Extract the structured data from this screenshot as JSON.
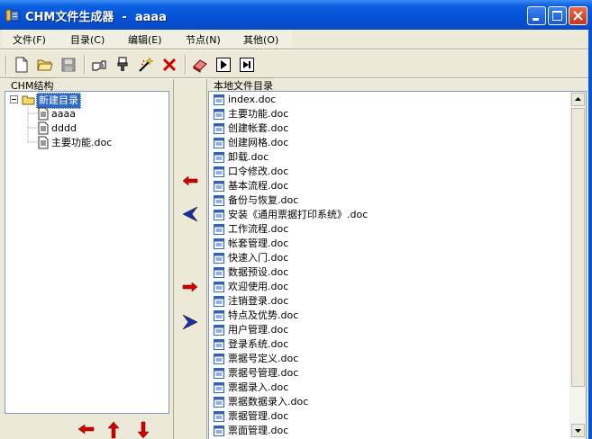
{
  "window": {
    "title": "CHM文件生成器  -  aaaa"
  },
  "menu": [
    "文件(F)",
    "目录(C)",
    "编辑(E)",
    "节点(N)",
    "其他(O)"
  ],
  "toolbar": {
    "icons": [
      "new-file-icon",
      "open-folder-icon",
      "save-icon",
      "hand-pointer-icon",
      "stamp-icon",
      "wand-icon",
      "delete-x-icon",
      "eraser-icon",
      "play-icon",
      "step-icon"
    ]
  },
  "left_panel": {
    "label": "CHM结构",
    "root": "新建目录",
    "children": [
      "aaaa",
      "dddd",
      "主要功能.doc"
    ]
  },
  "right_panel": {
    "label": "本地文件目录",
    "files": [
      "index.doc",
      "主要功能.doc",
      "创建帐套.doc",
      "创建网格.doc",
      "卸载.doc",
      "口令修改.doc",
      "基本流程.doc",
      "备份与恢复.doc",
      "安装《通用票据打印系统》.doc",
      "工作流程.doc",
      "帐套管理.doc",
      "快速入门.doc",
      "数据预设.doc",
      "欢迎使用.doc",
      "注销登录.doc",
      "特点及优势.doc",
      "用户管理.doc",
      "登录系统.doc",
      "票据号定义.doc",
      "票据号管理.doc",
      "票据录入.doc",
      "票据数据录入.doc",
      "票据管理.doc",
      "票面管理.doc"
    ]
  },
  "colors": {
    "title_blue": "#0553d8",
    "selection": "#316ac5",
    "arrow_red": "#d40000",
    "arrow_blue": "#1a2fa8"
  }
}
